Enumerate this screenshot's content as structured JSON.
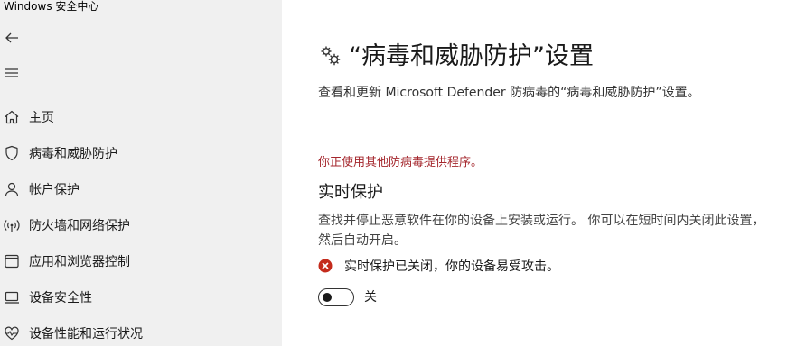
{
  "window": {
    "title": "Windows 安全中心"
  },
  "sidebar": {
    "items": [
      {
        "label": "主页",
        "icon": "home-icon"
      },
      {
        "label": "病毒和威胁防护",
        "icon": "shield-icon"
      },
      {
        "label": "帐户保护",
        "icon": "person-icon"
      },
      {
        "label": "防火墙和网络保护",
        "icon": "wifi-signal-icon"
      },
      {
        "label": "应用和浏览器控制",
        "icon": "app-window-icon"
      },
      {
        "label": "设备安全性",
        "icon": "laptop-icon"
      },
      {
        "label": "设备性能和运行状况",
        "icon": "heart-pulse-icon"
      }
    ]
  },
  "main": {
    "title": "“病毒和威胁防护”设置",
    "title_icon": "gears-icon",
    "description": "查看和更新 Microsoft Defender 防病毒的“病毒和威胁防护”设置。",
    "warning": "你正使用其他防病毒提供程序。",
    "realtime": {
      "title": "实时保护",
      "description": "查找并停止恶意软件在你的设备上安装或运行。 你可以在短时间内关闭此设置，然后自动开启。",
      "status_text": "实时保护已关闭，你的设备易受攻击。",
      "status_icon": "error-circle-icon",
      "toggle_label": "关",
      "toggle_on": false
    }
  },
  "colors": {
    "sidebar_bg": "#f0f0f0",
    "warning_text": "#a4262c",
    "error_icon": "#c42b1c"
  }
}
